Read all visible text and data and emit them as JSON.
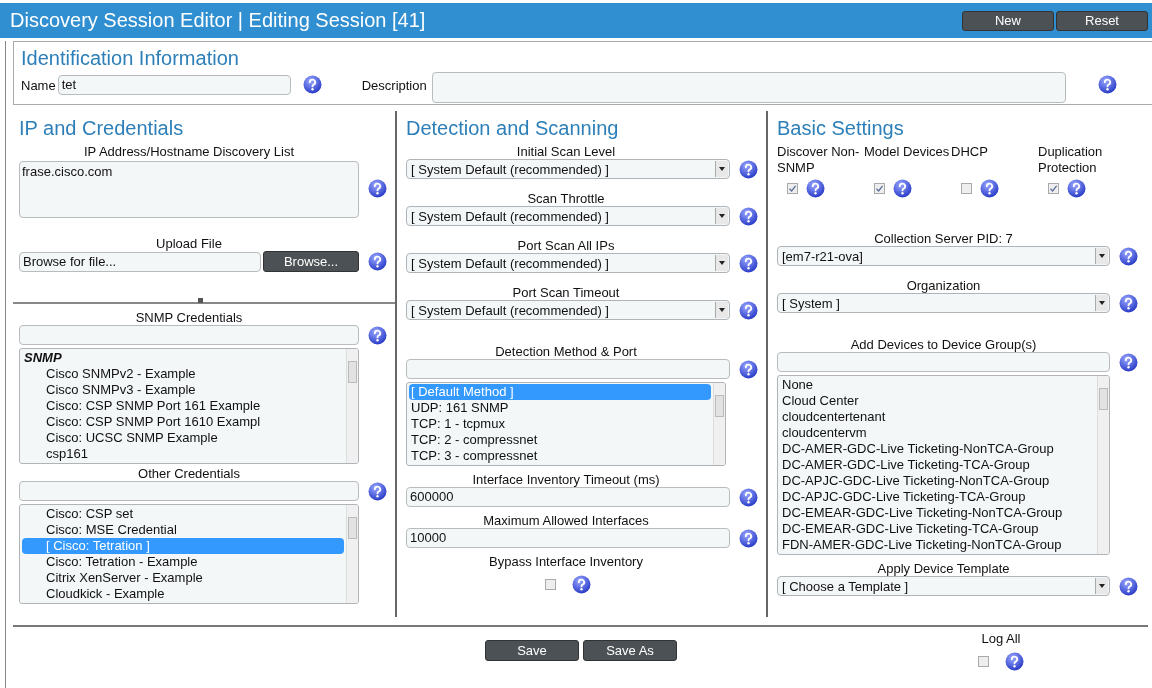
{
  "window": {
    "title": "Discovery Session Editor | Editing Session [41]"
  },
  "header_buttons": [
    "New",
    "Reset"
  ],
  "identification": {
    "heading": "Identification Information",
    "name": {
      "label": "Name",
      "value": "tet"
    },
    "description": {
      "label": "Description"
    }
  },
  "columns": [
    {
      "heading": "IP and Credentials",
      "fields": [
        {
          "kind": "textarea",
          "label": "IP Address/Hostname Discovery List",
          "value": "frase.cisco.com"
        },
        {
          "kind": "file",
          "label": "Upload File",
          "value": "Browse for file...",
          "button": "Browse..."
        },
        {
          "kind": "splitter"
        },
        {
          "kind": "credential_list",
          "label": "SNMP Credentials",
          "items": [
            {
              "kind": "group",
              "label": "SNMP"
            },
            {
              "kind": "option",
              "label": "Cisco SNMPv2 - Example",
              "selected": false
            },
            {
              "kind": "option",
              "label": "Cisco SNMPv3 - Example",
              "selected": false
            },
            {
              "kind": "option",
              "label": "Cisco: CSP SNMP Port 161 Example",
              "selected": false
            },
            {
              "kind": "option",
              "label": "Cisco: CSP SNMP Port 1610 Exampl",
              "selected": false
            },
            {
              "kind": "option",
              "label": "Cisco: UCSC SNMP Example",
              "selected": false
            },
            {
              "kind": "option",
              "label": "csp161",
              "selected": false
            }
          ]
        },
        {
          "kind": "credential_list",
          "label": "Other Credentials",
          "items": [
            {
              "kind": "option",
              "label": "Cisco: CSP set",
              "selected": false
            },
            {
              "kind": "option",
              "label": "Cisco: MSE Credential",
              "selected": false
            },
            {
              "kind": "option",
              "label": "[ Cisco: Tetration ]",
              "selected": true
            },
            {
              "kind": "option",
              "label": "Cisco: Tetration - Example",
              "selected": false
            },
            {
              "kind": "option",
              "label": "Citrix XenServer - Example",
              "selected": false
            },
            {
              "kind": "option",
              "label": "Cloudkick - Example",
              "selected": false
            }
          ]
        }
      ]
    },
    {
      "heading": "Detection and Scanning",
      "fields": [
        {
          "kind": "select",
          "label": "Initial Scan Level",
          "value": "[ System Default (recommended) ]"
        },
        {
          "kind": "select",
          "label": "Scan Throttle",
          "value": "[ System Default (recommended) ]"
        },
        {
          "kind": "select",
          "label": "Port Scan All IPs",
          "value": "[ System Default (recommended) ]"
        },
        {
          "kind": "select",
          "label": "Port Scan Timeout",
          "value": "[ System Default (recommended) ]"
        },
        {
          "kind": "list",
          "label": "Detection Method & Port",
          "items": [
            {
              "kind": "option",
              "label": "[ Default Method ]",
              "selected": true
            },
            {
              "kind": "option",
              "label": "UDP: 161 SNMP",
              "selected": false
            },
            {
              "kind": "option",
              "label": "TCP: 1 - tcpmux",
              "selected": false
            },
            {
              "kind": "option",
              "label": "TCP: 2 - compressnet",
              "selected": false
            },
            {
              "kind": "option",
              "label": "TCP: 3 - compressnet",
              "selected": false
            }
          ]
        },
        {
          "kind": "text",
          "label": "Interface Inventory Timeout (ms)",
          "value": "600000"
        },
        {
          "kind": "text",
          "label": "Maximum Allowed Interfaces",
          "value": "10000"
        },
        {
          "kind": "checkbox",
          "label": "Bypass Interface Inventory",
          "checked": false
        }
      ]
    },
    {
      "heading": "Basic Settings",
      "fields": [
        {
          "kind": "checkbox_row",
          "items": [
            {
              "label": "Discover Non-SNMP",
              "checked": true
            },
            {
              "label": "Model Devices",
              "checked": true
            },
            {
              "label": "DHCP",
              "checked": false
            },
            {
              "label": "Duplication Protection",
              "checked": true
            }
          ]
        },
        {
          "kind": "select",
          "label": "Collection Server PID: 7",
          "value": "[em7-r21-ova]"
        },
        {
          "kind": "select",
          "label": "Organization",
          "value": "[ System ]"
        },
        {
          "kind": "list",
          "label": "Add Devices to Device Group(s)",
          "items": [
            {
              "kind": "option",
              "label": "None",
              "selected": false
            },
            {
              "kind": "option",
              "label": "Cloud Center",
              "selected": false
            },
            {
              "kind": "option",
              "label": "cloudcentertenant",
              "selected": false
            },
            {
              "kind": "option",
              "label": "cloudcentervm",
              "selected": false
            },
            {
              "kind": "option",
              "label": "DC-AMER-GDC-Live Ticketing-NonTCA-Group",
              "selected": false
            },
            {
              "kind": "option",
              "label": "DC-AMER-GDC-Live Ticketing-TCA-Group",
              "selected": false
            },
            {
              "kind": "option",
              "label": "DC-APJC-GDC-Live Ticketing-NonTCA-Group",
              "selected": false
            },
            {
              "kind": "option",
              "label": "DC-APJC-GDC-Live Ticketing-TCA-Group",
              "selected": false
            },
            {
              "kind": "option",
              "label": "DC-EMEAR-GDC-Live Ticketing-NonTCA-Group",
              "selected": false
            },
            {
              "kind": "option",
              "label": "DC-EMEAR-GDC-Live Ticketing-TCA-Group",
              "selected": false
            },
            {
              "kind": "option",
              "label": "FDN-AMER-GDC-Live Ticketing-NonTCA-Group",
              "selected": false
            }
          ]
        },
        {
          "kind": "select",
          "label": "Apply Device Template",
          "value": "[ Choose a Template ]"
        }
      ]
    }
  ],
  "footer": {
    "buttons": [
      "Save",
      "Save As"
    ],
    "log_all": {
      "label": "Log All",
      "checked": false
    }
  }
}
